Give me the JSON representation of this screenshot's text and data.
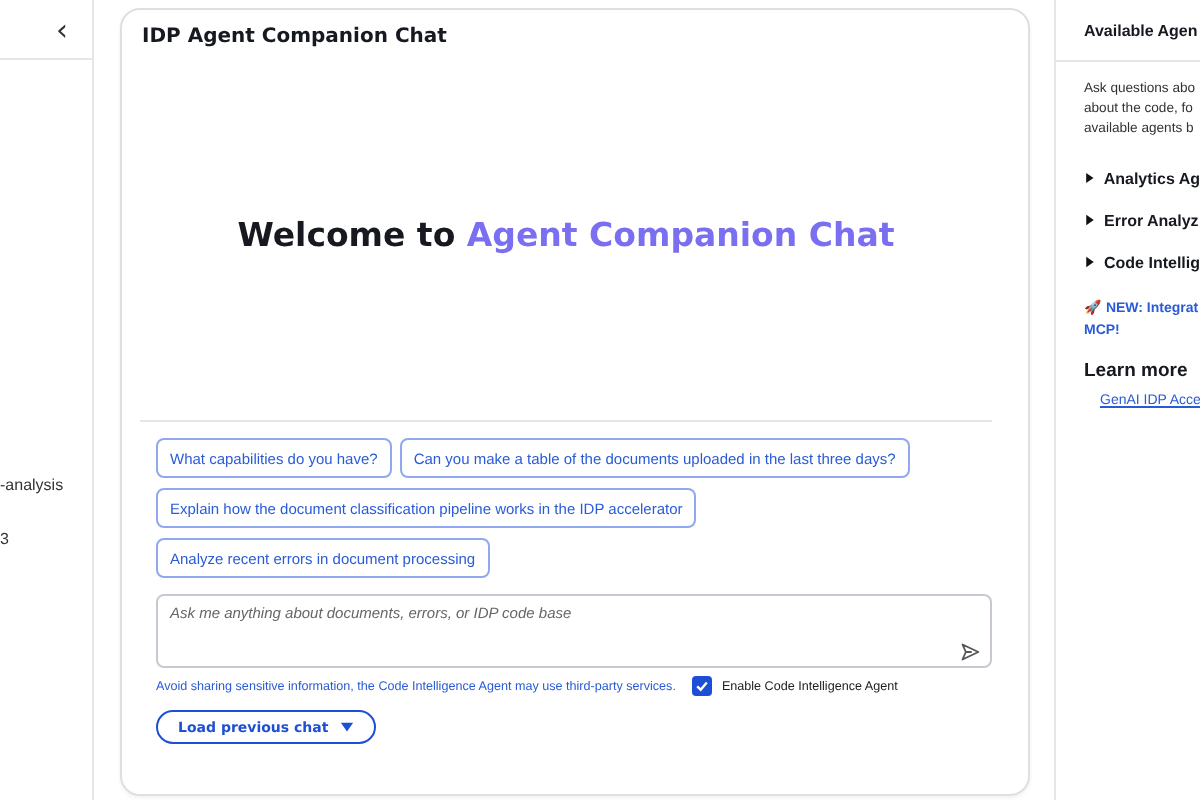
{
  "sidebar": {
    "collapse_icon": "‹",
    "items": [
      "-analysis",
      "3"
    ]
  },
  "chat": {
    "title": "IDP Agent Companion Chat",
    "welcome": {
      "lead": "Welcome to ",
      "highlight": "Agent Companion Chat"
    },
    "suggestions": [
      "What capabilities do you have?",
      "Can you make a table of the documents uploaded in the last three days?",
      "Explain how the document classification pipeline works in the IDP accelerator",
      "Analyze recent errors in document processing"
    ],
    "input": {
      "placeholder": "Ask me anything about documents, errors, or IDP code base"
    },
    "disclaimer": "Avoid sharing sensitive information, the Code Intelligence Agent may use third-party services.",
    "toggle": {
      "label": "Enable Code Intelligence Agent",
      "checked": true
    },
    "load_button": "Load previous chat"
  },
  "agents_panel": {
    "title": "Available Agen",
    "description": [
      "Ask questions abo",
      "about the code, fo",
      "available agents b"
    ],
    "agents": [
      {
        "label": "Analytics Ag",
        "expanded": false
      },
      {
        "label": "Error Analyz",
        "expanded": false
      },
      {
        "label": "Code Intellig",
        "expanded": false
      }
    ],
    "news": [
      "🚀 NEW: Integrat",
      "MCP!"
    ],
    "learn_more": "Learn more",
    "links": [
      "GenAI IDP Acce"
    ]
  }
}
